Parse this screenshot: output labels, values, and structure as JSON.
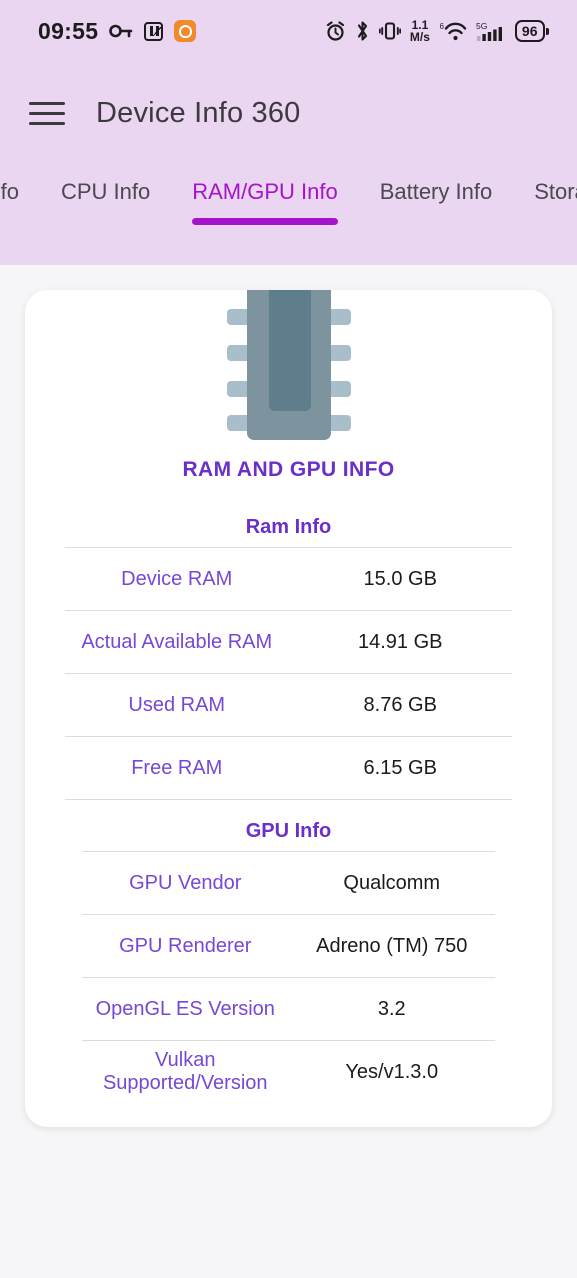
{
  "status_bar": {
    "time": "09:55",
    "left_icons": [
      "key-icon",
      "nfc-icon",
      "security-shield-icon"
    ],
    "network_speed": {
      "value": "1.1",
      "unit": "M/s"
    },
    "wifi_generation": "6",
    "mobile_network": "5G",
    "battery_percent": "96",
    "right_icons": [
      "alarm-icon",
      "bluetooth-icon",
      "vibrate-icon",
      "wifi-icon",
      "signal-icon",
      "battery-icon"
    ]
  },
  "app_bar": {
    "menu_icon": "hamburger-menu-icon",
    "title": "Device Info 360"
  },
  "tabs": {
    "items": [
      {
        "label": "ice Info",
        "active": false
      },
      {
        "label": "CPU Info",
        "active": false
      },
      {
        "label": "RAM/GPU Info",
        "active": true
      },
      {
        "label": "Battery Info",
        "active": false
      },
      {
        "label": "Stora",
        "active": false
      }
    ],
    "active_index": 2,
    "active_color": "#a614c9",
    "inactive_color": "#4c4750",
    "bar_background": "#ead6f0"
  },
  "card": {
    "icon": "memory-chip-icon",
    "icon_colors": {
      "body": "#7d939e",
      "core": "#5f7e8c",
      "pins": "#a9becb"
    },
    "title": "RAM AND GPU INFO",
    "title_color": "#6a30c9",
    "sections": [
      {
        "name": "ram",
        "heading": "Ram Info",
        "rows": [
          {
            "label": "Device RAM",
            "value": "15.0 GB"
          },
          {
            "label": "Actual Available RAM",
            "value": "14.91 GB"
          },
          {
            "label": "Used RAM",
            "value": "8.76 GB"
          },
          {
            "label": "Free RAM",
            "value": "6.15 GB"
          }
        ]
      },
      {
        "name": "gpu",
        "heading": "GPU Info",
        "rows": [
          {
            "label": "GPU Vendor",
            "value": "Qualcomm"
          },
          {
            "label": "GPU Renderer",
            "value": "Adreno (TM) 750"
          },
          {
            "label": "OpenGL ES Version",
            "value": "3.2"
          },
          {
            "label": "Vulkan Supported/Version",
            "value": "Yes/v1.3.0"
          }
        ]
      }
    ],
    "label_color": "#7747d6",
    "value_color": "#1b1b1b",
    "background": "#ffffff"
  }
}
